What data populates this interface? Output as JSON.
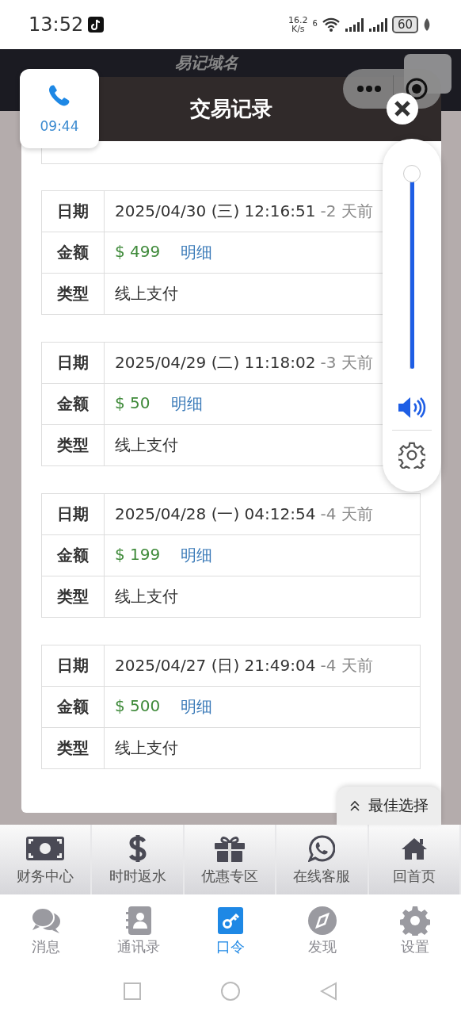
{
  "status_bar": {
    "time": "13:52",
    "net_speed": "16.2",
    "net_unit": "K/s",
    "wifi_label": "6",
    "battery": "60"
  },
  "backdrop": {
    "title": "易记域名"
  },
  "call_bubble": {
    "duration": "09:44"
  },
  "dialog": {
    "title": "交易记录"
  },
  "volume": {
    "level": 1
  },
  "records": [
    {
      "date_label": "日期",
      "date": "2025/04/30 (三) 12:16:51",
      "ago": "-2 天前",
      "amount_label": "金额",
      "amount": "$ 499",
      "detail": "明细",
      "type_label": "类型",
      "type": "线上支付"
    },
    {
      "date_label": "日期",
      "date": "2025/04/29 (二) 11:18:02",
      "ago": "-3 天前",
      "amount_label": "金额",
      "amount": "$ 50",
      "detail": "明细",
      "type_label": "类型",
      "type": "线上支付"
    },
    {
      "date_label": "日期",
      "date": "2025/04/28 (一) 04:12:54",
      "ago": "-4 天前",
      "amount_label": "金额",
      "amount": "$ 199",
      "detail": "明细",
      "type_label": "类型",
      "type": "线上支付"
    },
    {
      "date_label": "日期",
      "date": "2025/04/27 (日) 21:49:04",
      "ago": "-4 天前",
      "amount_label": "金额",
      "amount": "$ 500",
      "detail": "明细",
      "type_label": "类型",
      "type": "线上支付"
    }
  ],
  "best_choice": "最佳选择",
  "site_nav": [
    {
      "label": "财务中心",
      "kind": "cash"
    },
    {
      "label": "时时返水",
      "kind": "dollar"
    },
    {
      "label": "优惠专区",
      "kind": "gift"
    },
    {
      "label": "在线客服",
      "kind": "chat"
    },
    {
      "label": "回首页",
      "kind": "home"
    }
  ],
  "tab_bar": [
    {
      "label": "消息",
      "kind": "messages",
      "selected": false
    },
    {
      "label": "通讯录",
      "kind": "contacts",
      "selected": false
    },
    {
      "label": "口令",
      "kind": "key",
      "selected": true
    },
    {
      "label": "发现",
      "kind": "compass",
      "selected": false
    },
    {
      "label": "设置",
      "kind": "gear",
      "selected": false
    }
  ]
}
